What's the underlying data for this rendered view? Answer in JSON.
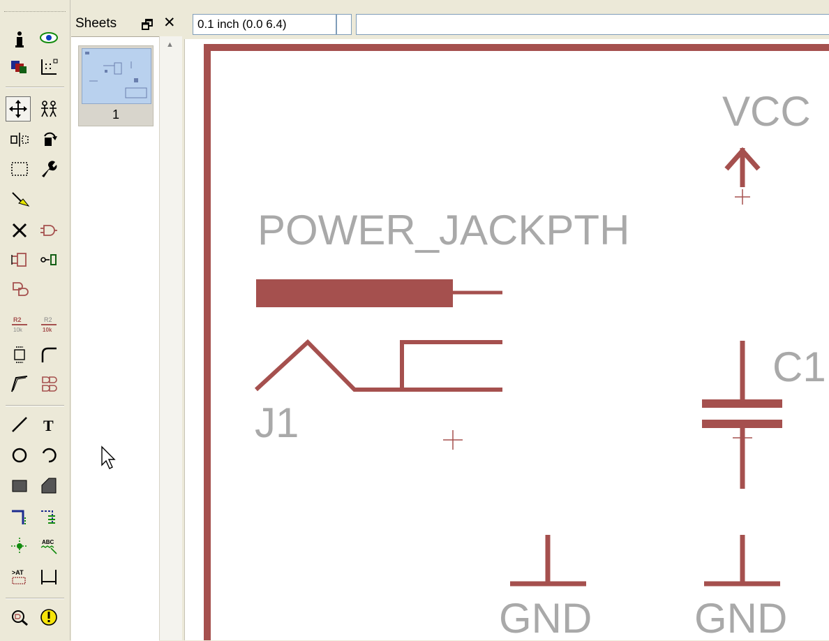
{
  "sheets_panel": {
    "title": "Sheets",
    "float_glyph": "🗗",
    "close_glyph": "✕",
    "thumbnails": [
      {
        "label": "1"
      }
    ]
  },
  "coord_display": {
    "value": "0.1 inch (0.0 6.4)"
  },
  "command_line": {
    "value": ""
  },
  "toolbar_tools": [
    "info-icon",
    "show-icon",
    "display-layers-icon",
    "grid-icon",
    "move-icon",
    "copy-icon",
    "mirror-icon",
    "rotate-icon",
    "group-icon",
    "change-icon",
    "paste-icon",
    "delete-icon",
    "add-icon",
    "pinswap-icon",
    "gateswap-icon",
    "replace-icon",
    "name-icon",
    "value-icon",
    "smash-icon",
    "miter-icon",
    "split-icon",
    "invoke-icon",
    "wire-icon",
    "text-icon",
    "circle-icon",
    "arc-icon",
    "rect-icon",
    "polygon-icon",
    "bus-icon",
    "net-icon",
    "junction-icon",
    "label-icon",
    "attribute-icon",
    "dimension-icon",
    "erc-icon",
    "errors-icon"
  ],
  "schematic": {
    "colors": {
      "symbol": "#a5504e",
      "text": "#a9a9a9",
      "frame": "#a5504e"
    },
    "labels": {
      "vcc": "VCC",
      "jack_name": "POWER_JACKPTH",
      "jack_ref": "J1",
      "cap_ref": "C1",
      "gnd1": "GND",
      "gnd2": "GND"
    }
  }
}
